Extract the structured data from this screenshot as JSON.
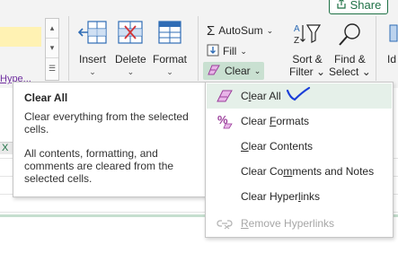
{
  "header": {
    "share_label": "Share"
  },
  "styles": {
    "hyperlink_style_label": "Hype..."
  },
  "cells_group": {
    "insert_label": "Insert",
    "delete_label": "Delete",
    "format_label": "Format"
  },
  "editing_group": {
    "autosum_label": "AutoSum",
    "fill_label": "Fill",
    "clear_label": "Clear",
    "sort_label_1": "Sort &",
    "sort_label_2": "Filter",
    "find_label_1": "Find &",
    "find_label_2": "Select",
    "partial_label": "Id"
  },
  "tooltip": {
    "title": "Clear All",
    "line1": "Clear everything from the selected cells.",
    "line2": "All contents, formatting, and comments are cleared from the selected cells."
  },
  "clear_menu": {
    "items": [
      {
        "pre": "C",
        "acc": "l",
        "post": "ear All",
        "icon": "eraser-icon",
        "state": "active"
      },
      {
        "pre": "Clear ",
        "acc": "F",
        "post": "ormats",
        "icon": "percent-format-icon",
        "state": "normal"
      },
      {
        "pre": "",
        "acc": "C",
        "post": "lear Contents",
        "icon": "",
        "state": "normal"
      },
      {
        "pre": "Clear Co",
        "acc": "m",
        "post": "ments and Notes",
        "icon": "",
        "state": "normal"
      },
      {
        "pre": "Clear Hyper",
        "acc": "l",
        "post": "inks",
        "icon": "",
        "state": "normal"
      },
      {
        "pre": "",
        "acc": "R",
        "post": "emove Hyperlinks",
        "icon": "remove-link-icon",
        "state": "disabled"
      }
    ]
  },
  "sheet": {
    "column_marker": "X"
  },
  "colors": {
    "accent_green": "#1e7145",
    "selected_bg": "#c9e0d1",
    "hover_bg": "#e5f0e9",
    "annotation_blue": "#1a3ed8"
  }
}
